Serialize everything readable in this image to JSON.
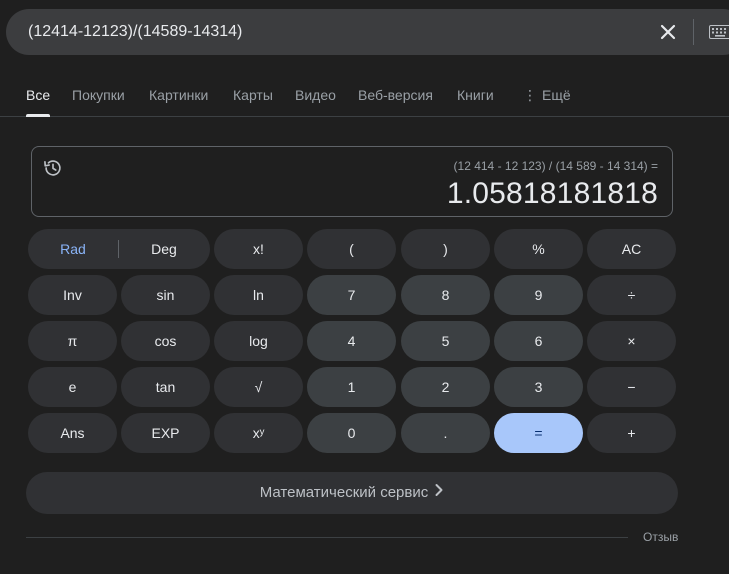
{
  "search": {
    "query": "(12414-12123)/(14589-14314)"
  },
  "tabs": [
    {
      "label": "Все",
      "active": true
    },
    {
      "label": "Покупки"
    },
    {
      "label": "Картинки"
    },
    {
      "label": "Карты"
    },
    {
      "label": "Видео"
    },
    {
      "label": "Веб-версия"
    },
    {
      "label": "Книги"
    },
    {
      "label": "Ещё"
    }
  ],
  "more_dots": "⋮",
  "calculator": {
    "expression": "(12 414 - 12 123) / (14 589 - 14 314) =",
    "result": "1.05818181818",
    "keys": {
      "rad": "Rad",
      "deg": "Deg",
      "factorial": "x!",
      "lparen": "(",
      "rparen": ")",
      "percent": "%",
      "ac": "AC",
      "inv": "Inv",
      "sin": "sin",
      "ln": "ln",
      "seven": "7",
      "eight": "8",
      "nine": "9",
      "divide": "÷",
      "pi": "π",
      "cos": "cos",
      "log": "log",
      "four": "4",
      "five": "5",
      "six": "6",
      "multiply": "×",
      "e": "e",
      "tan": "tan",
      "sqrt": "√",
      "one": "1",
      "two": "2",
      "three": "3",
      "minus": "−",
      "ans": "Ans",
      "exp": "EXP",
      "power": "xʸ",
      "zero": "0",
      "dot": ".",
      "equals": "=",
      "plus": "+"
    }
  },
  "math_service": {
    "label": "Математический сервис"
  },
  "feedback": "Отзыв",
  "colors": {
    "background": "#1f1f1f",
    "fn_key": "#303134",
    "num_key": "#3c4043",
    "equals_key": "#a8c7fa",
    "rad_active": "#8ab4f8"
  },
  "icons": {
    "clear": "close-icon",
    "keyboard": "keyboard-icon",
    "history": "history-icon",
    "chevron": "chevron-right-icon"
  }
}
